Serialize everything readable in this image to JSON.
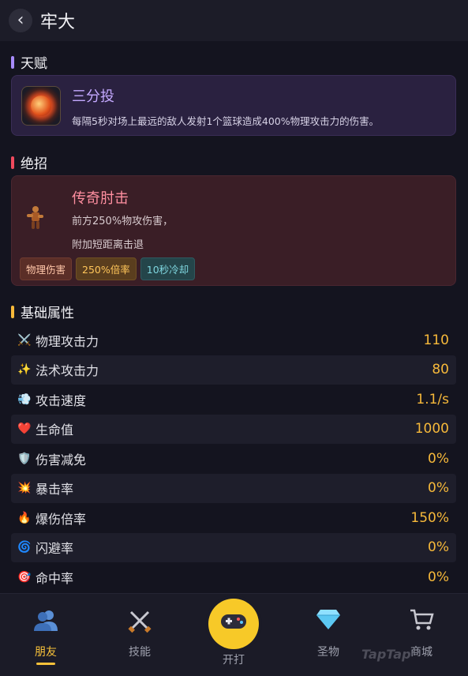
{
  "header": {
    "back_icon": "chevron-left-icon",
    "title": "牢大"
  },
  "talent": {
    "section_title": "天赋",
    "accent_color": "#a78bfa",
    "icon": "basketball-fire-icon",
    "name": "三分投",
    "description": "每隔5秒对场上最远的敌人发射1个篮球造成400%物理攻击力的伤害。"
  },
  "ultimate": {
    "section_title": "绝招",
    "accent_color": "#f04a5e",
    "icon": "character-sprite-icon",
    "name": "传奇肘击",
    "desc_line1": "前方250%物攻伤害，",
    "desc_line2": "附加短距离击退",
    "tags": [
      "物理伤害",
      "250%倍率",
      "10秒冷却"
    ]
  },
  "stats": {
    "section_title": "基础属性",
    "accent_color": "#f7b93a",
    "rows": [
      {
        "icon": "crossed-swords-icon",
        "glyph": "⚔️",
        "label": "物理攻击力",
        "value": "110"
      },
      {
        "icon": "sparkles-icon",
        "glyph": "✨",
        "label": "法术攻击力",
        "value": "80"
      },
      {
        "icon": "wind-icon",
        "glyph": "💨",
        "label": "攻击速度",
        "value": "1.1/s"
      },
      {
        "icon": "heart-icon",
        "glyph": "❤️",
        "label": "生命值",
        "value": "1000"
      },
      {
        "icon": "shield-icon",
        "glyph": "🛡️",
        "label": "伤害减免",
        "value": "0%"
      },
      {
        "icon": "collision-icon",
        "glyph": "💥",
        "label": "暴击率",
        "value": "0%"
      },
      {
        "icon": "fire-icon",
        "glyph": "🔥",
        "label": "爆伤倍率",
        "value": "150%"
      },
      {
        "icon": "cyclone-icon",
        "glyph": "🌀",
        "label": "闪避率",
        "value": "0%"
      },
      {
        "icon": "target-icon",
        "glyph": "🎯",
        "label": "命中率",
        "value": "0%"
      }
    ]
  },
  "nav": {
    "active_color": "#f7c13a",
    "items": [
      {
        "icon": "friends-icon",
        "label": "朋友",
        "active": true
      },
      {
        "icon": "swords-icon",
        "label": "技能",
        "active": false
      },
      {
        "icon": "gamepad-icon",
        "label": "开打",
        "active": false
      },
      {
        "icon": "diamond-icon",
        "label": "圣物",
        "active": false
      },
      {
        "icon": "cart-icon",
        "label": "商城",
        "active": false
      }
    ]
  },
  "watermark": "TapTap"
}
